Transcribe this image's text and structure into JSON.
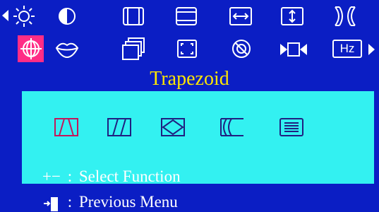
{
  "menu": {
    "row1_icons": [
      "arrow-left-icon",
      "brightness-icon",
      "contrast-icon",
      "h-size-icon",
      "v-size-icon",
      "h-position-icon",
      "v-position-icon",
      "pincushion-icon"
    ],
    "row2_icons": [
      "pin-balance-icon",
      "moire-icon",
      "parallelogram-icon",
      "zoom-icon",
      "degauss-icon",
      "recall-icon",
      "frequency-icon",
      "arrow-right-icon"
    ],
    "frequency_label": "Hz",
    "selected": "pin-balance-icon"
  },
  "submenu": {
    "title": "Trapezoid",
    "options": [
      "trapezoid-icon",
      "parallelogram-icon",
      "rotation-icon",
      "pin-balance-icon",
      "linearity-icon"
    ],
    "selected_option": "trapezoid-icon"
  },
  "help": {
    "select_keys": "+−",
    "select_sep": ":",
    "select_text": "Select Function",
    "back_sep": ":",
    "back_text": "Previous Menu"
  },
  "colors": {
    "background": "#0b1ec4",
    "panel": "#33f1f1",
    "title": "#ffe600",
    "selected_highlight": "#ff2d86",
    "icons": "#ffffff",
    "panel_icon_selected": "#c2185b",
    "panel_icon": "#202080"
  }
}
